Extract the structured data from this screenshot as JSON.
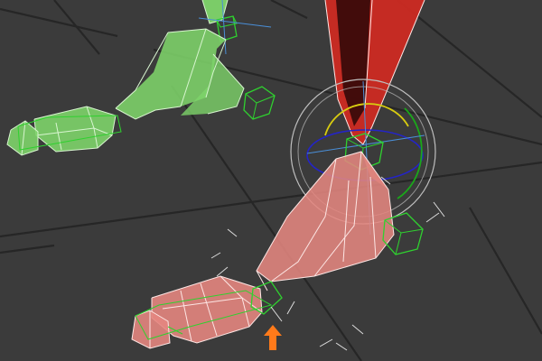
{
  "viewport": {
    "background_color": "#3b3b3b",
    "grid_color": "#262626"
  },
  "rig": {
    "left_leg": {
      "color": "#7ed46a",
      "edge_color": "#d8f5d0",
      "control_color": "#2fd12f"
    },
    "right_leg": {
      "color": "#e4867f",
      "edge_color": "#fde6e4",
      "control_color": "#2fd12f",
      "thigh_color": "#cc2a22"
    },
    "rotate_gizmo": {
      "outer_ring_color": "#bfbfbf",
      "x_axis_color": "#2424c8",
      "y_axis_color": "#d8cc10",
      "z_axis_color": "#1aa81a",
      "pivot_axis_color": "#4a8fd8"
    },
    "indicator": {
      "color": "#ff7a1a",
      "icon": "arrow-up-icon"
    }
  }
}
